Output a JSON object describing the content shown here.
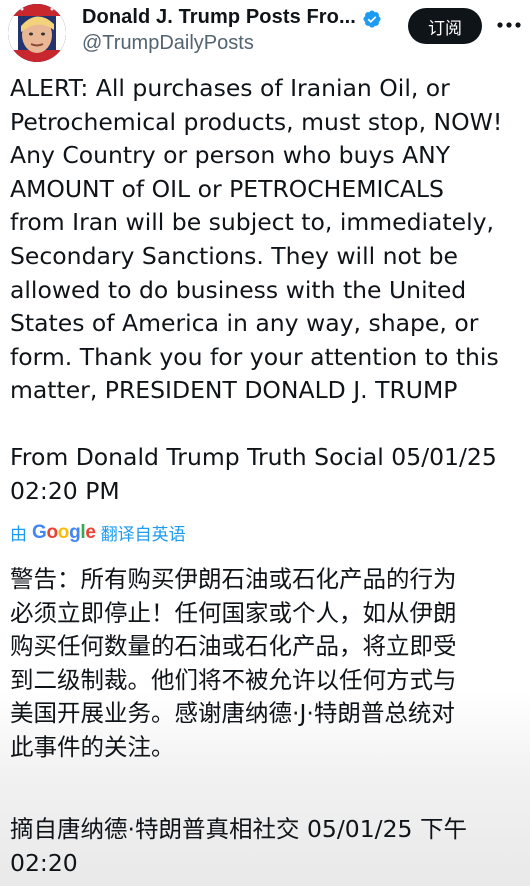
{
  "header": {
    "display_name": "Donald J. Trump Posts Fro...",
    "handle": "@TrumpDailyPosts",
    "follow_label": "订阅"
  },
  "tweet": {
    "text": "ALERT: All purchases of Iranian Oil, or\nPetrochemical products, must stop, NOW!\nAny Country or person who buys ANY\nAMOUNT of OIL or PETROCHEMICALS\nfrom Iran will be subject to, immediately,\nSecondary Sanctions. They will not be\nallowed to do business with the United\nStates of America in any way, shape, or\nform. Thank you for your attention to this\nmatter, PRESIDENT DONALD J. TRUMP",
    "source_line": "From Donald Trump Truth Social 05/01/25\n02:20 PM"
  },
  "translation": {
    "prefix": "由",
    "provider_g1": "G",
    "provider_o1": "o",
    "provider_o2": "o",
    "provider_g2": "g",
    "provider_l": "l",
    "provider_e": "e",
    "suffix": "翻译自英语",
    "text": "警告：所有购买伊朗石油或石化产品的行为\n必须立即停止！任何国家或个人，如从伊朗\n购买任何数量的石油或石化产品，将立即受\n到二级制裁。他们将不被允许以任何方式与\n美国开展业务。感谢唐纳德·J·特朗普总统对\n此事件的关注。",
    "source_line": "摘自唐纳德·特朗普真相社交 05/01/25 下午\n02:20"
  },
  "colors": {
    "accent": "#1d9bf0",
    "verified": "#1d9bf0",
    "follow_bg": "#0f1419"
  }
}
